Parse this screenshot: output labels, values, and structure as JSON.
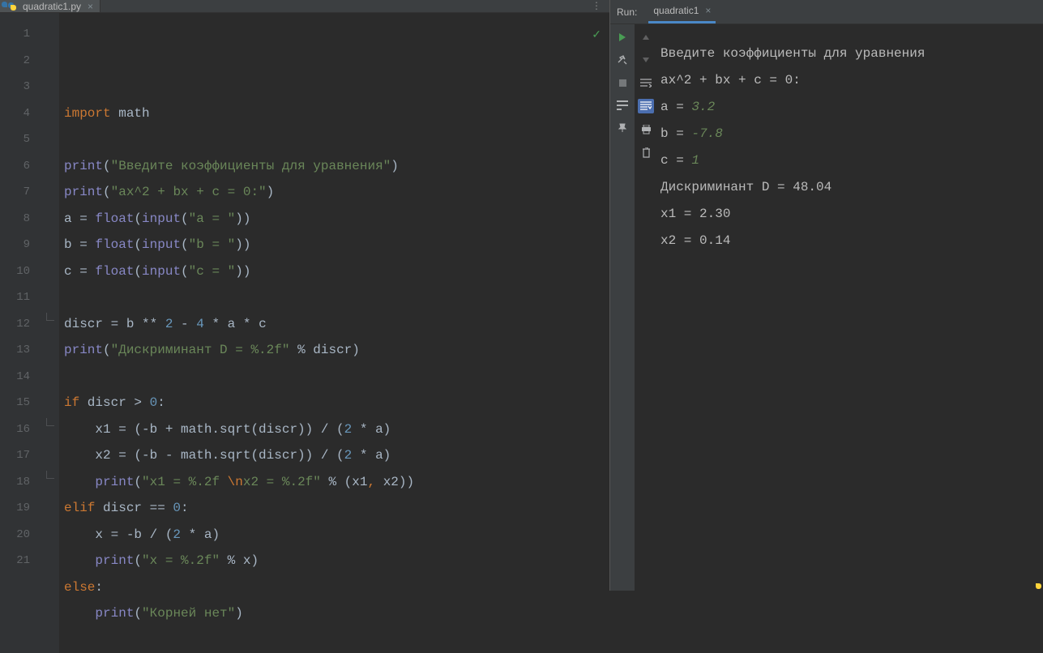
{
  "editor": {
    "tab_label": "quadratic1.py",
    "lines": 21,
    "code": [
      [
        {
          "c": "kw",
          "t": "import"
        },
        {
          "c": "",
          "t": " math"
        }
      ],
      [],
      [
        {
          "c": "bi",
          "t": "print"
        },
        {
          "c": "",
          "t": "("
        },
        {
          "c": "str",
          "t": "\"Введите коэффициенты для уравнения\""
        },
        {
          "c": "",
          "t": ")"
        }
      ],
      [
        {
          "c": "bi",
          "t": "print"
        },
        {
          "c": "",
          "t": "("
        },
        {
          "c": "str",
          "t": "\"ax^2 + bx + c = 0:\""
        },
        {
          "c": "",
          "t": ")"
        }
      ],
      [
        {
          "c": "",
          "t": "a = "
        },
        {
          "c": "bi",
          "t": "float"
        },
        {
          "c": "",
          "t": "("
        },
        {
          "c": "bi",
          "t": "input"
        },
        {
          "c": "",
          "t": "("
        },
        {
          "c": "str",
          "t": "\"a = \""
        },
        {
          "c": "",
          "t": "))"
        }
      ],
      [
        {
          "c": "",
          "t": "b = "
        },
        {
          "c": "bi",
          "t": "float"
        },
        {
          "c": "",
          "t": "("
        },
        {
          "c": "bi",
          "t": "input"
        },
        {
          "c": "",
          "t": "("
        },
        {
          "c": "str",
          "t": "\"b = \""
        },
        {
          "c": "",
          "t": "))"
        }
      ],
      [
        {
          "c": "",
          "t": "c = "
        },
        {
          "c": "bi",
          "t": "float"
        },
        {
          "c": "",
          "t": "("
        },
        {
          "c": "bi",
          "t": "input"
        },
        {
          "c": "",
          "t": "("
        },
        {
          "c": "str",
          "t": "\"c = \""
        },
        {
          "c": "",
          "t": "))"
        }
      ],
      [],
      [
        {
          "c": "",
          "t": "discr = b ** "
        },
        {
          "c": "num",
          "t": "2"
        },
        {
          "c": "",
          "t": " - "
        },
        {
          "c": "num",
          "t": "4"
        },
        {
          "c": "",
          "t": " * a * c"
        }
      ],
      [
        {
          "c": "bi",
          "t": "print"
        },
        {
          "c": "",
          "t": "("
        },
        {
          "c": "str",
          "t": "\"Дискриминант D = %.2f\""
        },
        {
          "c": "",
          "t": " % discr)"
        }
      ],
      [],
      [
        {
          "c": "kw",
          "t": "if"
        },
        {
          "c": "",
          "t": " discr > "
        },
        {
          "c": "num",
          "t": "0"
        },
        {
          "c": "",
          "t": ":"
        }
      ],
      [
        {
          "c": "",
          "t": "    x1 = (-b + math.sqrt(discr)) / ("
        },
        {
          "c": "num",
          "t": "2"
        },
        {
          "c": "",
          "t": " * a)"
        }
      ],
      [
        {
          "c": "",
          "t": "    x2 = (-b - math.sqrt(discr)) / ("
        },
        {
          "c": "num",
          "t": "2"
        },
        {
          "c": "",
          "t": " * a)"
        }
      ],
      [
        {
          "c": "",
          "t": "    "
        },
        {
          "c": "bi",
          "t": "print"
        },
        {
          "c": "",
          "t": "("
        },
        {
          "c": "str",
          "t": "\"x1 = %.2f "
        },
        {
          "c": "esc",
          "t": "\\n"
        },
        {
          "c": "str",
          "t": "x2 = %.2f\""
        },
        {
          "c": "",
          "t": " % (x1"
        },
        {
          "c": "kw",
          "t": ","
        },
        {
          "c": "",
          "t": " x2))"
        }
      ],
      [
        {
          "c": "kw",
          "t": "elif"
        },
        {
          "c": "",
          "t": " discr == "
        },
        {
          "c": "num",
          "t": "0"
        },
        {
          "c": "",
          "t": ":"
        }
      ],
      [
        {
          "c": "",
          "t": "    x = -b / ("
        },
        {
          "c": "num",
          "t": "2"
        },
        {
          "c": "",
          "t": " * a)"
        }
      ],
      [
        {
          "c": "",
          "t": "    "
        },
        {
          "c": "bi",
          "t": "print"
        },
        {
          "c": "",
          "t": "("
        },
        {
          "c": "str",
          "t": "\"x = %.2f\""
        },
        {
          "c": "",
          "t": " % x)"
        }
      ],
      [
        {
          "c": "kw",
          "t": "else"
        },
        {
          "c": "",
          "t": ":"
        }
      ],
      [
        {
          "c": "",
          "t": "    "
        },
        {
          "c": "bi",
          "t": "print"
        },
        {
          "c": "",
          "t": "("
        },
        {
          "c": "str",
          "t": "\"Корней нет\""
        },
        {
          "c": "",
          "t": ")"
        }
      ],
      []
    ]
  },
  "run": {
    "title": "Run:",
    "tab_label": "quadratic1",
    "output": [
      [
        {
          "c": "",
          "t": "Введите коэффициенты для уравнения"
        }
      ],
      [
        {
          "c": "",
          "t": "ax^2 + bx + c = 0:"
        }
      ],
      [
        {
          "c": "",
          "t": "a = "
        },
        {
          "c": "inp",
          "t": "3.2"
        }
      ],
      [
        {
          "c": "",
          "t": "b = "
        },
        {
          "c": "inp",
          "t": "-7.8"
        }
      ],
      [
        {
          "c": "",
          "t": "c = "
        },
        {
          "c": "inp",
          "t": "1"
        }
      ],
      [
        {
          "c": "",
          "t": "Дискриминант D = 48.04"
        }
      ],
      [
        {
          "c": "",
          "t": "x1 = 2.30"
        }
      ],
      [
        {
          "c": "",
          "t": "x2 = 0.14"
        }
      ]
    ]
  }
}
